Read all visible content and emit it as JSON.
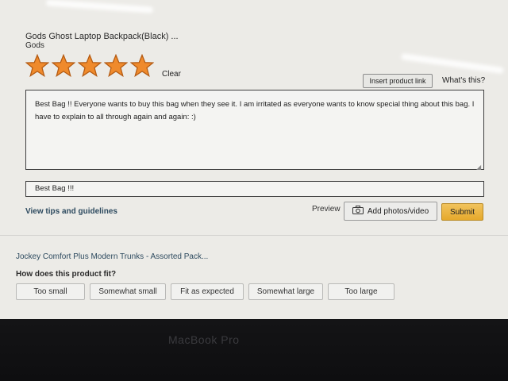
{
  "review": {
    "product_title": "Gods Ghost Laptop Backpack(Black) ...",
    "brand": "Gods",
    "rating": 5,
    "rating_max": 5,
    "star_color": "#ef8a2c",
    "clear_label": "Clear",
    "insert_product_link_label": "Insert product link",
    "whats_this_label": "What's this?",
    "body_text": "Best Bag !! Everyone wants to buy this bag when they see it. I am irritated as everyone wants to know special thing about this bag. I have to explain to all through again and again: :)",
    "headline_text": "Best Bag !!!",
    "guidelines_label": "View tips and guidelines",
    "preview_label": "Preview",
    "add_photos_label": "Add photos/video",
    "submit_label": "Submit"
  },
  "next_product": {
    "title": "Jockey Comfort Plus Modern Trunks - Assorted Pack...",
    "fit_question": "How does this product fit?",
    "fit_options": [
      "Too small",
      "Somewhat small",
      "Fit as expected",
      "Somewhat large",
      "Too large"
    ]
  },
  "device": {
    "bezel_label": "MacBook Pro"
  }
}
